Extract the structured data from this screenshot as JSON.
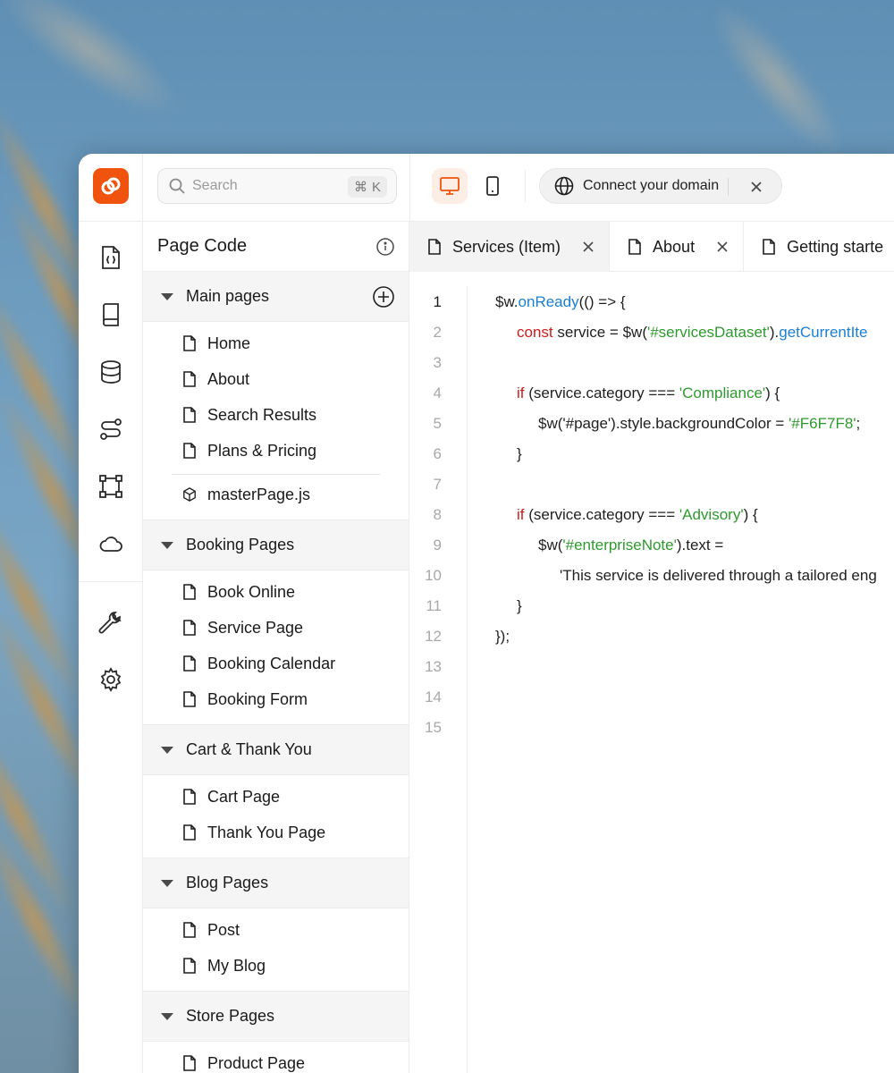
{
  "search": {
    "placeholder": "Search",
    "shortcut_symbol": "⌘",
    "shortcut_key": "K"
  },
  "domain": {
    "label": "Connect your domain"
  },
  "colors": {
    "accent": "#f0530d",
    "keyword": "#d11a1a",
    "string": "#2e9a2e",
    "function": "#1a7fd4"
  },
  "rail": {
    "icons": [
      "code-file-icon",
      "book-icon",
      "database-icon",
      "workflow-icon",
      "frame-icon",
      "cloud-icon",
      "wrench-icon",
      "gear-icon"
    ]
  },
  "panel": {
    "title": "Page Code",
    "groups": [
      {
        "label": "Main pages",
        "items": [
          "Home",
          "About",
          "Search Results",
          "Plans & Pricing"
        ],
        "extra": "masterPage.js"
      },
      {
        "label": "Booking Pages",
        "items": [
          "Book Online",
          "Service Page",
          "Booking Calendar",
          "Booking Form"
        ]
      },
      {
        "label": "Cart & Thank You",
        "items": [
          "Cart Page",
          "Thank You Page"
        ]
      },
      {
        "label": "Blog Pages",
        "items": [
          "Post",
          "My Blog"
        ]
      },
      {
        "label": "Store Pages",
        "items": [
          "Product Page"
        ]
      }
    ]
  },
  "tabs": [
    {
      "label": "Services (Item)",
      "active": true
    },
    {
      "label": "About",
      "active": false
    },
    {
      "label": "Getting starte",
      "active": false
    }
  ],
  "editor": {
    "current_line": 1,
    "line_numbers": [
      "1",
      "2",
      "3",
      "4",
      "5",
      "6",
      "7",
      "8",
      "9",
      "10",
      "11",
      "12",
      "13",
      "14",
      "15"
    ],
    "lines": [
      [
        [
          "",
          "$w."
        ],
        [
          "fn",
          "onReady"
        ],
        [
          "",
          "(() => {"
        ]
      ],
      [
        [
          "kw",
          "const"
        ],
        [
          "",
          " service = $w("
        ],
        [
          "str",
          "'#servicesDataset'"
        ],
        [
          "",
          ")."
        ],
        [
          "fn",
          "getCurrentIte"
        ]
      ],
      [],
      [
        [
          "kw",
          "if"
        ],
        [
          "",
          " (service.category === "
        ],
        [
          "str",
          "'Compliance'"
        ],
        [
          "",
          ") {"
        ]
      ],
      [
        [
          "",
          "$w('#page').style.backgroundColor = "
        ],
        [
          "str",
          "'#F6F7F8'"
        ],
        [
          "",
          ";"
        ]
      ],
      [
        [
          "",
          "}"
        ]
      ],
      [],
      [
        [
          "kw",
          "if"
        ],
        [
          "",
          " (service.category === "
        ],
        [
          "str",
          "'Advisory'"
        ],
        [
          "",
          ") {"
        ]
      ],
      [
        [
          "",
          "$w("
        ],
        [
          "str",
          "'#enterpriseNote'"
        ],
        [
          "",
          ").text ="
        ]
      ],
      [
        [
          "",
          "'This service is delivered through a tailored eng"
        ]
      ],
      [
        [
          "",
          "}"
        ]
      ],
      [
        [
          "",
          "});"
        ]
      ],
      [],
      [],
      []
    ]
  }
}
